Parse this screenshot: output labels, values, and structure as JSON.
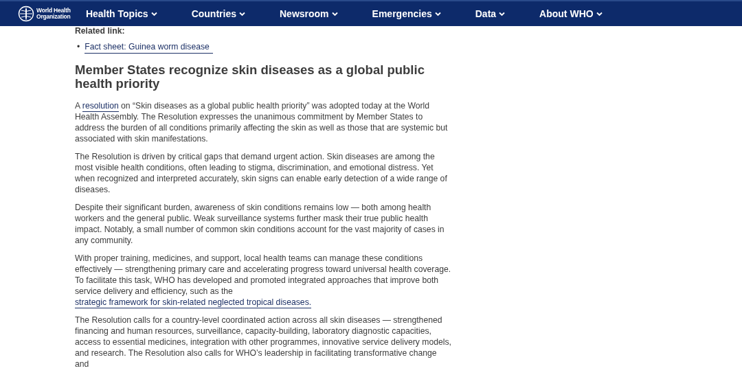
{
  "header": {
    "logo": {
      "line_1": "World Health",
      "line_2": "Organization"
    },
    "nav": [
      {
        "label": "Health Topics"
      },
      {
        "label": "Countries"
      },
      {
        "label": "Newsroom"
      },
      {
        "label": "Emergencies"
      },
      {
        "label": "Data"
      },
      {
        "label": "About WHO"
      }
    ]
  },
  "related": {
    "label": "Related link:",
    "links": [
      {
        "marker": "•",
        "text": "Fact sheet: Guinea worm disease"
      }
    ]
  },
  "heading": "Member States recognize skin diseases as a global public health priority",
  "paragraphs": [
    [
      {
        "kind": "text",
        "text": "A "
      },
      {
        "kind": "link",
        "text": "resolution"
      },
      {
        "kind": "text",
        "text": " on “Skin diseases as a global public health priority” was adopted today at the World Health Assembly. The Resolution expresses the unanimous commitment by Member States to address the burden of all conditions primarily affecting the skin as well as those that are systemic but associated with skin manifestations."
      }
    ],
    [
      {
        "kind": "text",
        "text": "The Resolution is driven by critical gaps that demand urgent action. Skin diseases are among the most visible health conditions, often leading to stigma, discrimination, and emotional distress. Yet when recognized and interpreted accurately, skin signs can enable early detection of a wide range of diseases."
      }
    ],
    [
      {
        "kind": "text",
        "text": "Despite their significant burden, awareness of skin conditions remains low — both among health workers and the general public. Weak surveillance systems further mask their true public health impact. Notably, a small number of common skin conditions account for the vast majority of cases in any community."
      }
    ],
    [
      {
        "kind": "text",
        "text": "With proper training, medicines, and support, local health teams can manage these conditions effectively — strengthening primary care and accelerating progress toward universal health coverage. To facilitate this task, WHO has developed and promoted integrated approaches that improve both service delivery and efficiency, such as the "
      },
      {
        "kind": "link",
        "text": "strategic framework for skin-related neglected tropical diseases."
      }
    ],
    [
      {
        "kind": "text",
        "text": "The Resolution calls for a country-level coordinated action across all skin diseases — strengthened financing and human resources, surveillance, capacity-building, laboratory diagnostic capacities, access to essential medicines, integration with other programmes, innovative service delivery models, and research. The Resolution also calls for WHO’s leadership in facilitating transformative change and"
      }
    ]
  ]
}
